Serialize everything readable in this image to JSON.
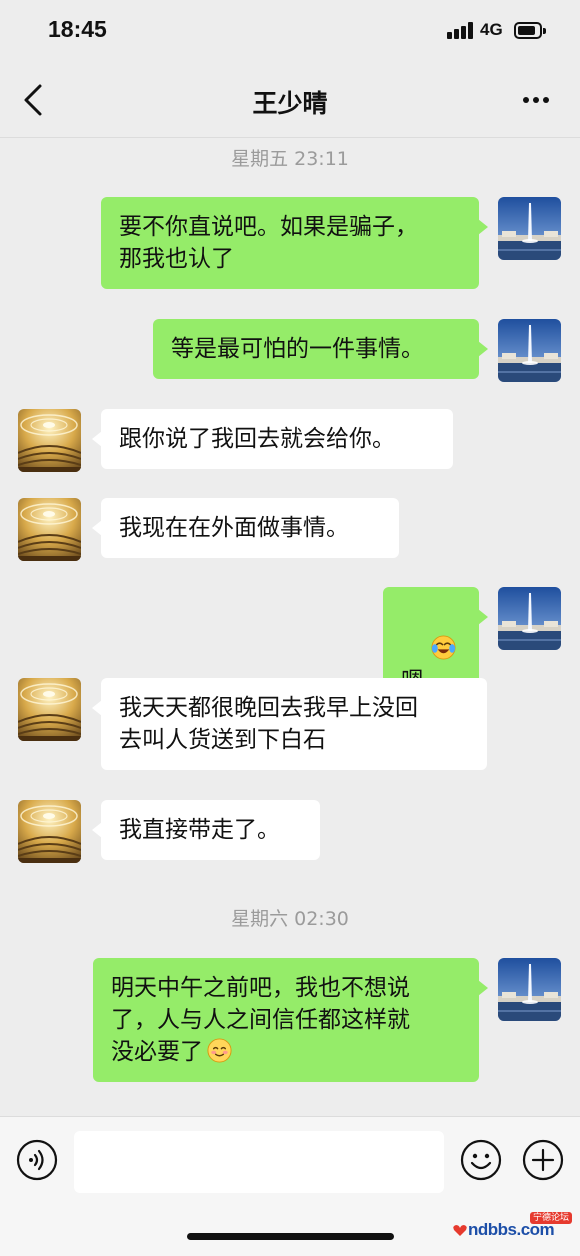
{
  "status_bar": {
    "time": "18:45",
    "network": "4G"
  },
  "nav": {
    "title": "王少晴"
  },
  "chat": {
    "timestamps": [
      "星期五 23:11",
      "星期六 02:30"
    ],
    "messages": [
      {
        "side": "right",
        "text": "要不你直说吧。如果是骗子，\n那我也认了"
      },
      {
        "side": "right",
        "text": "等是最可怕的一件事情。"
      },
      {
        "side": "left",
        "text": "跟你说了我回去就会给你。"
      },
      {
        "side": "left",
        "text": "我现在在外面做事情。"
      },
      {
        "side": "right",
        "text": "嗯",
        "emoji": "crying-laughing-emoji"
      },
      {
        "side": "left",
        "text": "我天天都很晚回去我早上没回\n去叫人货送到下白石"
      },
      {
        "side": "left",
        "text": "我直接带走了。"
      },
      {
        "side": "right",
        "text": "明天中午之前吧，我也不想说\n了，人与人之间信任都这样就\n没必要了",
        "emoji": "blushing-smile-emoji"
      }
    ]
  },
  "watermark": {
    "text": "ndbbs.com",
    "tag": "宁德论坛"
  },
  "colors": {
    "sent_bubble": "#95ec69",
    "received_bubble": "#ffffff",
    "background": "#ededed"
  }
}
